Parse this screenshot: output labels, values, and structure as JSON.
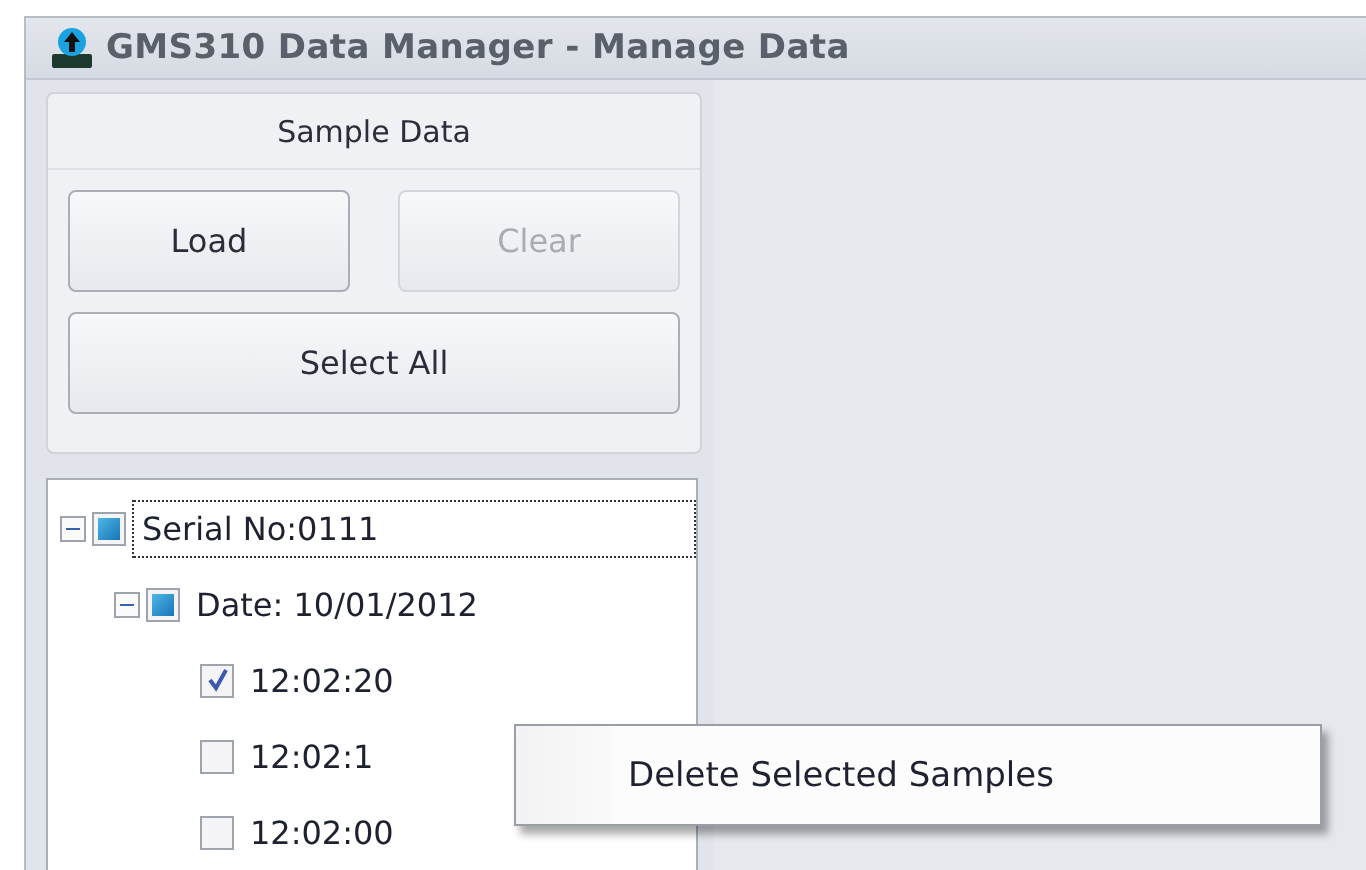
{
  "window": {
    "title": "GMS310 Data Manager - Manage Data"
  },
  "sample_data": {
    "title": "Sample Data",
    "buttons": [
      {
        "label": "Load",
        "disabled": false
      },
      {
        "label": "Clear",
        "disabled": true
      }
    ],
    "select_all": {
      "label": "Select All",
      "disabled": false
    }
  },
  "tree": [
    {
      "label": "Serial No:0111",
      "checked": false,
      "partial": true,
      "expanded": true,
      "focused": true,
      "children": [
        {
          "label": "Date: 10/01/2012",
          "checked": false,
          "partial": true,
          "expanded": true,
          "focused": false,
          "children": [
            {
              "label": "12:02:20",
              "checked": true,
              "focused": false
            },
            {
              "label": "12:02:1",
              "checked": false,
              "focused": false
            },
            {
              "label": "12:02:00",
              "checked": false,
              "focused": false
            }
          ]
        }
      ]
    }
  ],
  "context_menu": {
    "items": [
      {
        "label": "Delete Selected Samples"
      }
    ]
  }
}
